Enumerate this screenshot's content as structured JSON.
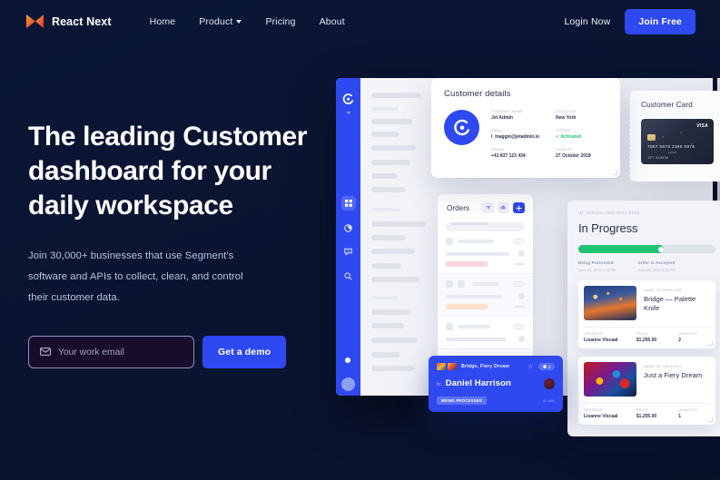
{
  "brand": {
    "name": "React Next",
    "logo_icon": "bowtie-logo-icon",
    "gradient_from": "#f7a23b",
    "gradient_to": "#e03c31"
  },
  "nav": {
    "links": [
      {
        "label": "Home",
        "has_caret": false
      },
      {
        "label": "Product",
        "has_caret": true
      },
      {
        "label": "Pricing",
        "has_caret": false
      },
      {
        "label": "About",
        "has_caret": false
      }
    ],
    "login_label": "Login Now",
    "join_label": "Join Free",
    "accent": "#2f49f0"
  },
  "hero": {
    "heading": "The leading Customer dashboard for your daily workspace",
    "subtext": "Join 30,000+ businesses that use Segment's software and APIs to collect, clean, and control their customer data.",
    "email_placeholder": "Your work email",
    "email_value": "",
    "email_icon": "envelope-icon",
    "cta_label": "Get a demo"
  },
  "mock": {
    "sidebar": {
      "logo_icon": "spiral-logo-icon",
      "items": [
        {
          "icon": "grid-dashboard-icon",
          "active": true
        },
        {
          "icon": "pie-chart-icon",
          "active": false
        },
        {
          "icon": "chat-bubble-icon",
          "active": false
        },
        {
          "icon": "search-icon",
          "active": false
        }
      ],
      "avatar_icon": "user-avatar"
    },
    "customer_details": {
      "title": "Customer details",
      "avatar_icon": "spiral-avatar-icon",
      "fields": [
        {
          "label": "COMPANY NAME",
          "value": "Jet Admin",
          "green": false
        },
        {
          "label": "LOCATION",
          "value": "New York",
          "green": false
        },
        {
          "label": "EMAIL",
          "value": "l_maggio@jetadmin.io",
          "green": false
        },
        {
          "label": "STATUS",
          "value": "✓ Activated",
          "green": true
        },
        {
          "label": "PHONE",
          "value": "+41 837 123 434",
          "green": false
        },
        {
          "label": "SIGN UP",
          "value": "27 October 2018",
          "green": false
        }
      ]
    },
    "customer_card": {
      "title": "Customer Card",
      "brand": "VISA",
      "number": "7867  5678  2369  5978",
      "expiry": "12/22",
      "holder": "JET ADMIN"
    },
    "orders": {
      "title": "Orders",
      "actions": [
        {
          "icon": "filter-icon",
          "primary": false
        },
        {
          "icon": "refresh-cloud-icon",
          "primary": false
        },
        {
          "icon": "plus-icon",
          "primary": true
        }
      ]
    },
    "blue_card": {
      "title": "Bridge, Fiery Dream",
      "star_icon": "star-outline-icon",
      "badge_icon": "cart-icon",
      "badge_count": "2",
      "to_prefix": "to:",
      "customer": "Daniel Harrison",
      "status": "BEING PROCESSED",
      "time": "42 MIN"
    },
    "progress": {
      "order_id": "ID: 3563f3c-c54f-4421-b305",
      "title": "In Progress",
      "percent": 62,
      "bar_color": "#1ec472",
      "steps": [
        {
          "label": "Being Processed",
          "time": "June 25, 2019 1:22 PM"
        },
        {
          "label": "Order is Accepted",
          "time": "June 25, 2019 4:15 PM"
        }
      ],
      "items": [
        {
          "name_label": "NAME OF PAINTING",
          "name": "Bridge — Palette Knife",
          "thumb": "bridge",
          "orderer_label": "ORDERER",
          "orderer": "Lisanne Viscaal",
          "price_label": "PRICE",
          "price": "$1,255.00",
          "qty_label": "QUANTITY",
          "qty": "2"
        },
        {
          "name_label": "NAME OF PAINTING",
          "name": "Just a Fiery Dream",
          "thumb": "fiery",
          "orderer_label": "ORDERER",
          "orderer": "Lisanne Viscaal",
          "price_label": "PRICE",
          "price": "$1,255.00",
          "qty_label": "QUANTITY",
          "qty": "1"
        }
      ]
    }
  }
}
